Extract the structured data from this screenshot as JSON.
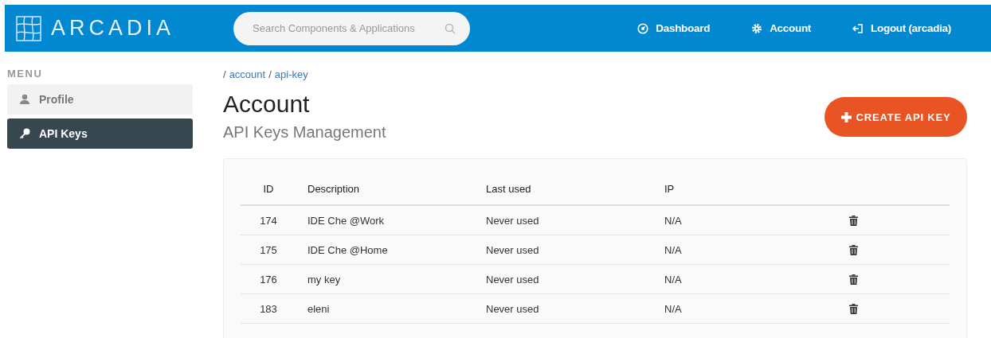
{
  "header": {
    "logo": "ARCADIA",
    "search": {
      "placeholder": "Search Components & Applications"
    },
    "nav": [
      {
        "label": "Dashboard",
        "kind": "dashboard"
      },
      {
        "label": "Account",
        "kind": "settings"
      },
      {
        "label": "Logout (arcadia)",
        "kind": "logout"
      }
    ]
  },
  "sidebar": {
    "heading": "MENU",
    "items": [
      {
        "label": "Profile",
        "kind": "profile",
        "selected": false
      },
      {
        "label": "API Keys",
        "kind": "key",
        "selected": true
      }
    ]
  },
  "breadcrumb": [
    {
      "separator": "/",
      "label": "account"
    },
    {
      "separator": "/",
      "label": "api-key"
    }
  ],
  "title": "Account",
  "subtitle": "API Keys Management",
  "create_button": "CREATE API KEY",
  "table": {
    "columns": [
      "ID",
      "Description",
      "Last used",
      "IP"
    ],
    "rows": [
      {
        "id": "174",
        "description": "IDE Che @Work",
        "last_used": "Never used",
        "ip": "N/A"
      },
      {
        "id": "175",
        "description": "IDE Che @Home",
        "last_used": "Never used",
        "ip": "N/A"
      },
      {
        "id": "176",
        "description": "my key",
        "last_used": "Never used",
        "ip": "N/A"
      },
      {
        "id": "183",
        "description": "eleni",
        "last_used": "Never used",
        "ip": "N/A"
      }
    ]
  }
}
